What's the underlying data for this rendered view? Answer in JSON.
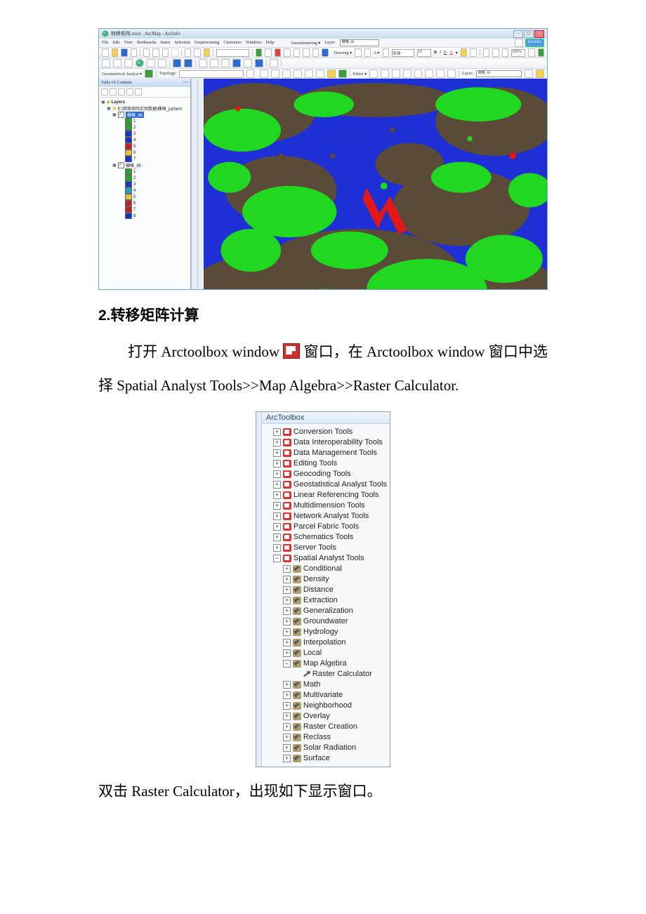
{
  "arcmap": {
    "title": "转移矩阵.mxd - ArcMap - ArcInfo",
    "speed_badge": "826 KB/s",
    "menubar": [
      "File",
      "Edit",
      "View",
      "Bookmarks",
      "Insert",
      "Selection",
      "Geoprocessing",
      "Customize",
      "Windows",
      "Help"
    ],
    "georef_label": "Georeferencing ▾",
    "layer_label_top": "Layer:",
    "layer_value_top": "栅格_86",
    "drawing_label": "Drawing ▾",
    "drawing_font_sample": "宋体",
    "font_size": "10",
    "zoom_pct": "100%",
    "geostat_label": "Geostatistical Analyst ▾",
    "topology_label": "Topology:",
    "editor_label": "Editor ▾",
    "layer_label_bottom": "Layer:",
    "layer_value_bottom": "栅格_86",
    "toc": {
      "panel_title": "Table Of Contents",
      "layers_label": "Layers",
      "source_path": "E:\\转移矩阵实验数据\\栅格_juzhen\\",
      "layers": [
        {
          "name": "栅格_86",
          "selected": true,
          "classes": [
            {
              "v": "1",
              "c": "#2aa02a"
            },
            {
              "v": "2",
              "c": "#2aa02a"
            },
            {
              "v": "3",
              "c": "#1535c8"
            },
            {
              "v": "4",
              "c": "#1535c8"
            },
            {
              "v": "5",
              "c": "#c62020"
            },
            {
              "v": "6",
              "c": "#e0c040"
            },
            {
              "v": "7",
              "c": "#1535c8"
            }
          ]
        },
        {
          "name": "栅格_95",
          "selected": false,
          "classes": [
            {
              "v": "1",
              "c": "#2aa02a"
            },
            {
              "v": "2",
              "c": "#2aa02a"
            },
            {
              "v": "3",
              "c": "#1535c8"
            },
            {
              "v": "4",
              "c": "#20a0c0"
            },
            {
              "v": "5",
              "c": "#e0c040"
            },
            {
              "v": "6",
              "c": "#c62020"
            },
            {
              "v": "7",
              "c": "#c62020"
            },
            {
              "v": "8",
              "c": "#1535c8"
            }
          ]
        }
      ]
    }
  },
  "doc": {
    "heading": "2.转移矩阵计算",
    "para_a": "打开 Arctoolbox window ",
    "para_b": " 窗口，在 Arctoolbox window 窗口中选择 Spatial  Analyst  Tools>>Map  Algebra>>Raster Calculator.",
    "closing": "双击 Raster Calculator，出现如下显示窗口。"
  },
  "arctoolbox": {
    "title": "ArcToolbox",
    "toolboxes": [
      "Conversion Tools",
      "Data Interoperability Tools",
      "Data Management Tools",
      "Editing Tools",
      "Geocoding Tools",
      "Geostatistical Analyst Tools",
      "Linear Referencing Tools",
      "Multidimension Tools",
      "Network Analyst Tools",
      "Parcel Fabric Tools",
      "Schematics Tools",
      "Server Tools"
    ],
    "spatial_analyst": {
      "label": "Spatial Analyst Tools",
      "toolsets": [
        "Conditional",
        "Density",
        "Distance",
        "Extraction",
        "Generalization",
        "Groundwater",
        "Hydrology",
        "Interpolation",
        "Local"
      ],
      "map_algebra": {
        "label": "Map Algebra",
        "tool": "Raster Calculator"
      },
      "toolsets_after": [
        "Math",
        "Multivariate",
        "Neighborhood",
        "Overlay",
        "Raster Creation",
        "Reclass",
        "Solar Radiation",
        "Surface"
      ]
    }
  }
}
